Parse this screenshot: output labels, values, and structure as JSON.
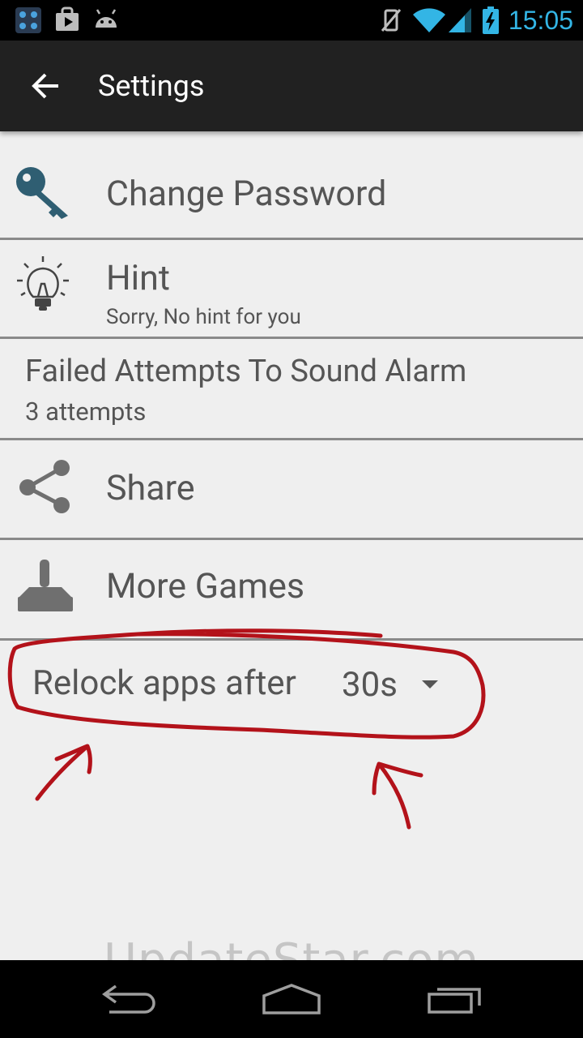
{
  "status_bar": {
    "time": "15:05",
    "accent_color": "#33b5e5",
    "left_icons": [
      "app-grid-icon",
      "play-store-icon",
      "android-icon"
    ],
    "right_icons": [
      "vibrate-off-icon",
      "wifi-icon",
      "signal-icon",
      "battery-charging-icon"
    ]
  },
  "action_bar": {
    "title": "Settings",
    "back_icon": "back-arrow-icon"
  },
  "settings": {
    "change_password": {
      "title": "Change Password",
      "icon": "key-icon"
    },
    "hint": {
      "title": "Hint",
      "subtitle": "Sorry, No hint for you",
      "icon": "lightbulb-icon"
    },
    "failed_attempts": {
      "title": "Failed Attempts To Sound Alarm",
      "subtitle": "3 attempts"
    },
    "share": {
      "title": "Share",
      "icon": "share-icon"
    },
    "more_games": {
      "title": "More Games",
      "icon": "joystick-icon"
    },
    "relock": {
      "label": "Relock apps after",
      "value": "30s"
    }
  },
  "annotation": {
    "color": "#b3121a"
  },
  "watermark": "UpdateStar.com",
  "nav_bar": {
    "icons": [
      "back-nav-icon",
      "home-nav-icon",
      "recents-nav-icon"
    ]
  }
}
